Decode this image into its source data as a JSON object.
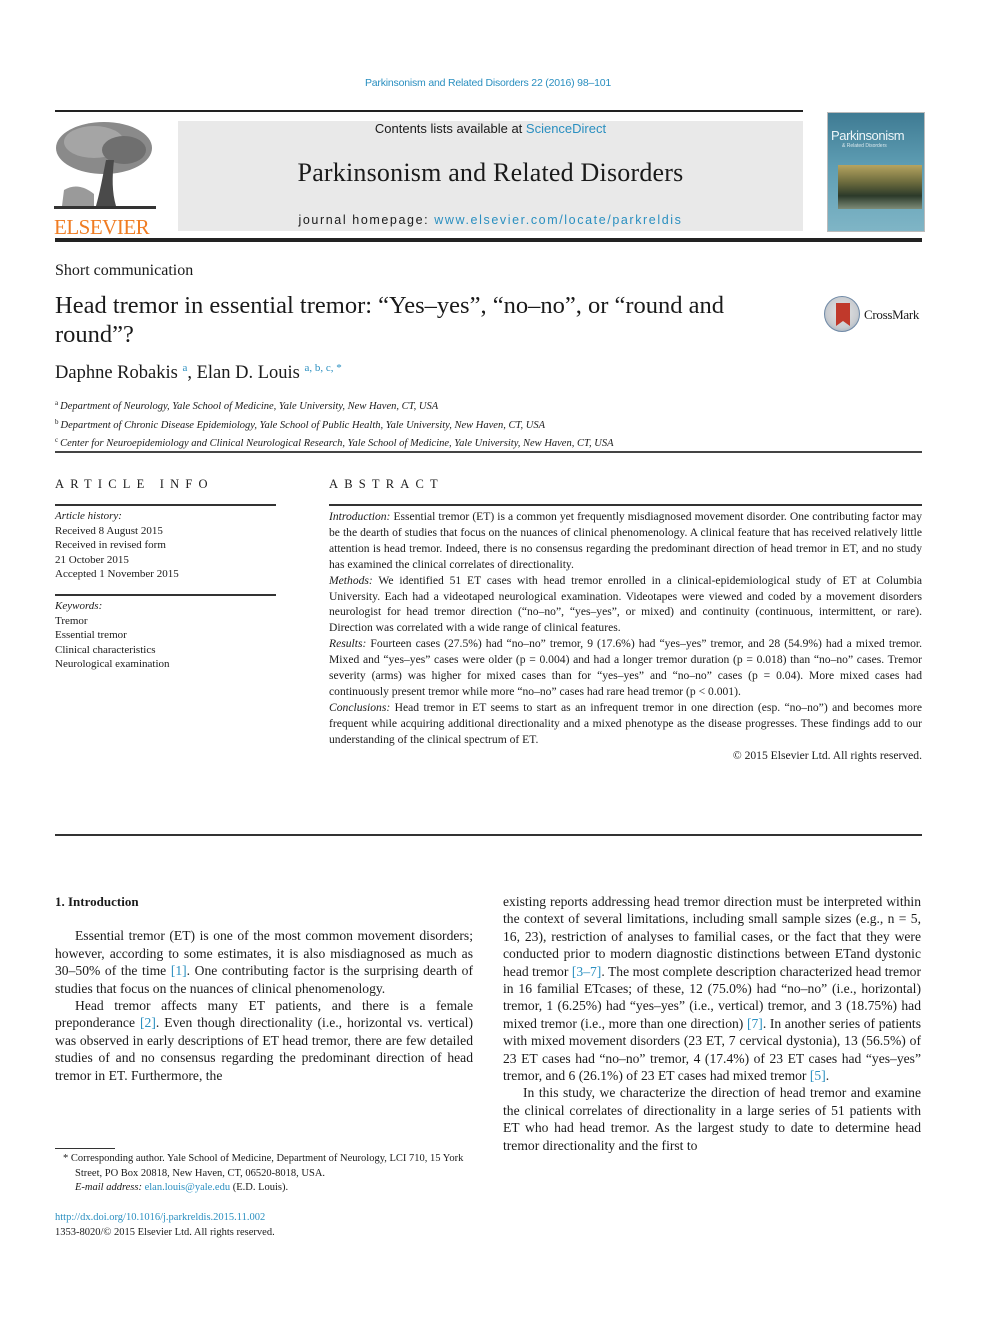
{
  "header": {
    "citation": "Parkinsonism and Related Disorders 22 (2016) 98–101",
    "publisher_logo_text": "ELSEVIER",
    "contents_prefix": "Contents lists available at ",
    "contents_link": "ScienceDirect",
    "journal_title": "Parkinsonism and Related Disorders",
    "homepage_prefix": "journal homepage: ",
    "homepage_link": "www.elsevier.com/locate/parkreldis",
    "cover_title": "Parkinsonism",
    "cover_subtitle": "& Related Disorders"
  },
  "article": {
    "type": "Short communication",
    "title": "Head tremor in essential tremor: “Yes–yes”, “no–no”, or “round and round”?",
    "crossmark_label": "CrossMark",
    "authors": [
      {
        "name": "Daphne Robakis",
        "sup": "a"
      },
      {
        "name": "Elan D. Louis",
        "sup": "a, b, c, *"
      }
    ],
    "affiliations": [
      {
        "key": "a",
        "text": "Department of Neurology, Yale School of Medicine, Yale University, New Haven, CT, USA"
      },
      {
        "key": "b",
        "text": "Department of Chronic Disease Epidemiology, Yale School of Public Health, Yale University, New Haven, CT, USA"
      },
      {
        "key": "c",
        "text": "Center for Neuroepidemiology and Clinical Neurological Research, Yale School of Medicine, Yale University, New Haven, CT, USA"
      }
    ]
  },
  "article_info": {
    "heading": "ARTICLE INFO",
    "history_label": "Article history:",
    "history": [
      "Received 8 August 2015",
      "Received in revised form",
      "21 October 2015",
      "Accepted 1 November 2015"
    ],
    "keywords_label": "Keywords:",
    "keywords": [
      "Tremor",
      "Essential tremor",
      "Clinical characteristics",
      "Neurological examination"
    ]
  },
  "abstract": {
    "heading": "ABSTRACT",
    "sections": [
      {
        "label": "Introduction:",
        "text": " Essential tremor (ET) is a common yet frequently misdiagnosed movement disorder. One contributing factor may be the dearth of studies that focus on the nuances of clinical phenomenology. A clinical feature that has received relatively little attention is head tremor. Indeed, there is no consensus regarding the predominant direction of head tremor in ET, and no study has examined the clinical correlates of directionality."
      },
      {
        "label": "Methods:",
        "text": " We identified 51 ET cases with head tremor enrolled in a clinical-epidemiological study of ET at Columbia University. Each had a videotaped neurological examination. Videotapes were viewed and coded by a movement disorders neurologist for head tremor direction (“no–no”, “yes–yes”, or mixed) and continuity (continuous, intermittent, or rare). Direction was correlated with a wide range of clinical features."
      },
      {
        "label": "Results:",
        "text": " Fourteen cases (27.5%) had “no–no” tremor, 9 (17.6%) had “yes–yes” tremor, and 28 (54.9%) had a mixed tremor. Mixed and “yes–yes” cases were older (p = 0.004) and had a longer tremor duration (p = 0.018) than “no–no” cases. Tremor severity (arms) was higher for mixed cases than for “yes–yes” and “no–no” cases (p = 0.04). More mixed cases had continuously present tremor while more “no–no” cases had rare head tremor (p < 0.001)."
      },
      {
        "label": "Conclusions:",
        "text": " Head tremor in ET seems to start as an infrequent tremor in one direction (esp. “no–no”) and becomes more frequent while acquiring additional directionality and a mixed phenotype as the disease progresses. These findings add to our understanding of the clinical spectrum of ET."
      }
    ],
    "copyright": "© 2015 Elsevier Ltd. All rights reserved."
  },
  "body": {
    "section_heading": "1.  Introduction",
    "left_paragraphs": [
      [
        {
          "t": "Essential tremor (ET) is one of the most common movement disorders; however, according to some estimates, it is also misdiagnosed as much as 30–50% of the time "
        },
        {
          "ref": "[1]"
        },
        {
          "t": ". One contributing factor is the surprising dearth of studies that focus on the nuances of clinical phenomenology."
        }
      ],
      [
        {
          "t": "Head tremor affects many ET patients, and there is a female preponderance "
        },
        {
          "ref": "[2]"
        },
        {
          "t": ". Even though directionality (i.e., horizontal vs. vertical) was observed in early descriptions of ET head tremor, there are few detailed studies of and no consensus regarding the predominant direction of head tremor in ET. Furthermore, the"
        }
      ]
    ],
    "right_paragraphs": [
      [
        {
          "t": "existing reports addressing head tremor direction must be interpreted within the context of several limitations, including small sample sizes (e.g., n = 5, 16, 23), restriction of analyses to familial cases, or the fact that they were conducted prior to modern diagnostic distinctions between ETand dystonic head tremor "
        },
        {
          "ref": "[3–7]"
        },
        {
          "t": ". The most complete description characterized head tremor in 16 familial ETcases; of these, 12 (75.0%) had “no–no” (i.e., horizontal) tremor, 1 (6.25%) had “yes–yes” (i.e., vertical) tremor, and 3 (18.75%) had mixed tremor (i.e., more than one direction) "
        },
        {
          "ref": "[7]"
        },
        {
          "t": ". In another series of patients with mixed movement disorders (23 ET, 7 cervical dystonia), 13 (56.5%) of 23 ET cases had “no–no” tremor, 4 (17.4%) of 23 ET cases had “yes–yes” tremor, and 6 (26.1%) of 23 ET cases had mixed tremor "
        },
        {
          "ref": "[5]"
        },
        {
          "t": "."
        }
      ],
      [
        {
          "t": "In this study, we characterize the direction of head tremor and examine the clinical correlates of directionality in a large series of 51 patients with ET who had head tremor. As the largest study to date to determine head tremor directionality and the first to"
        }
      ]
    ]
  },
  "footnote": {
    "corresponding": "* Corresponding author. Yale School of Medicine, Department of Neurology, LCI 710, 15 York Street, PO Box 20818, New Haven, CT, 06520-8018, USA.",
    "email_label": "E-mail address:",
    "email": "elan.louis@yale.edu",
    "email_suffix": " (E.D. Louis).",
    "doi": "http://dx.doi.org/10.1016/j.parkreldis.2015.11.002",
    "issn": "1353-8020/© 2015 Elsevier Ltd. All rights reserved."
  }
}
